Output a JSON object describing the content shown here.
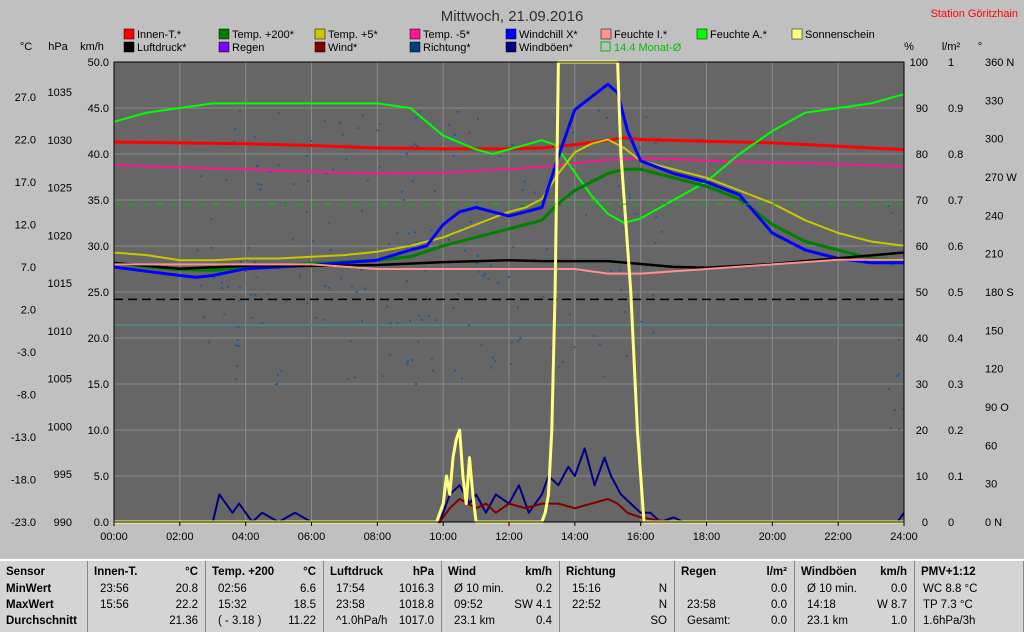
{
  "title": "Mittwoch, 21.09.2016",
  "station": "Station Göritzhain",
  "colors": {
    "bg": "#c0c0c0",
    "plot": "#666666"
  },
  "legend": [
    {
      "label": "Innen-T.*",
      "color": "#ff0000"
    },
    {
      "label": "Temp. +200*",
      "color": "#008000"
    },
    {
      "label": "Temp. +5*",
      "color": "#c8c800"
    },
    {
      "label": "Temp. -5*",
      "color": "#ff1493"
    },
    {
      "label": "Windchill X*",
      "color": "#0000ff"
    },
    {
      "label": "Feuchte I.*",
      "color": "#ff9090"
    },
    {
      "label": "Feuchte A.*",
      "color": "#00ff00"
    },
    {
      "label": "Sonnenschein",
      "color": "#ffff80"
    },
    {
      "label": "Luftdruck*",
      "color": "#000000"
    },
    {
      "label": "Regen",
      "color": "#8000ff"
    },
    {
      "label": "Wind*",
      "color": "#800000"
    },
    {
      "label": "Richtung*",
      "color": "#004080"
    },
    {
      "label": "Windböen*",
      "color": "#000080"
    },
    {
      "label": "14.4 Monat-Ø",
      "color": "#00c000",
      "box": true
    }
  ],
  "chart_data": {
    "type": "line",
    "title": "Mittwoch, 21.09.2016",
    "x_ticks": [
      "00:00",
      "02:00",
      "04:00",
      "06:00",
      "08:00",
      "10:00",
      "12:00",
      "14:00",
      "16:00",
      "18:00",
      "20:00",
      "22:00",
      "24:00"
    ],
    "xlim": [
      0,
      24
    ],
    "axes": {
      "celsius": {
        "label": "°C",
        "ticks": [
          "27.0",
          "22.0",
          "17.0",
          "12.0",
          "7.0",
          "2.0",
          "-3.0",
          "-8.0",
          "-13.0",
          "-18.0",
          "-23.0"
        ]
      },
      "hpa": {
        "label": "hPa",
        "ticks": [
          "1035",
          "1030",
          "1025",
          "1020",
          "1015",
          "1010",
          "1005",
          "1000",
          "995",
          "990"
        ]
      },
      "kmh": {
        "label": "km/h",
        "ticks": [
          "50.0",
          "45.0",
          "40.0",
          "35.0",
          "30.0",
          "25.0",
          "20.0",
          "15.0",
          "10.0",
          "5.0",
          "0.0"
        ]
      },
      "percent": {
        "label": "%",
        "ticks": [
          "100",
          "90",
          "80",
          "70",
          "60",
          "50",
          "40",
          "30",
          "20",
          "10",
          "0"
        ]
      },
      "lm2": {
        "label": "l/m²",
        "ticks": [
          "1",
          "0.9",
          "0.8",
          "0.7",
          "0.6",
          "0.5",
          "0.4",
          "0.3",
          "0.2",
          "0.1",
          "0"
        ]
      },
      "degree": {
        "label": "°",
        "ticks": [
          "360 N",
          "330",
          "300",
          "270 W",
          "240",
          "210",
          "180 S",
          "150",
          "120",
          "90 O",
          "60",
          "30",
          "0 N"
        ]
      }
    },
    "series": [
      {
        "name": "Innen-T.*",
        "axis": "celsius",
        "x": [
          0,
          2,
          4,
          6,
          8,
          10,
          12,
          13,
          14,
          15,
          15.5,
          16,
          18,
          20,
          22,
          24
        ],
        "y": [
          21.7,
          21.6,
          21.5,
          21.3,
          21.0,
          20.9,
          20.9,
          21.0,
          21.4,
          21.9,
          22.2,
          22.0,
          21.8,
          21.6,
          21.2,
          20.8
        ]
      },
      {
        "name": "Temp. -5*",
        "axis": "celsius",
        "x": [
          0,
          2,
          4,
          6,
          8,
          10,
          12,
          13,
          14,
          15,
          16,
          17,
          18,
          20,
          22,
          24
        ],
        "y": [
          19.0,
          18.7,
          18.5,
          18.2,
          18.0,
          18.1,
          18.5,
          18.8,
          19.2,
          19.6,
          19.8,
          19.7,
          19.5,
          19.3,
          19.1,
          18.8
        ]
      },
      {
        "name": "Feuchte A.*",
        "axis": "percent",
        "x": [
          0,
          0.5,
          1,
          2,
          3,
          4,
          6,
          8,
          9,
          9.5,
          10,
          11,
          11.5,
          12,
          12.5,
          13,
          13.4,
          14,
          14.5,
          15,
          15.5,
          16,
          17,
          18,
          19,
          20,
          21,
          22,
          23,
          24
        ],
        "y": [
          87,
          88,
          89,
          90,
          91,
          91,
          91,
          91,
          90,
          87,
          84,
          81,
          80,
          81,
          82,
          83,
          82,
          76,
          71,
          67,
          65,
          66,
          70,
          74,
          80,
          85,
          89,
          90,
          91,
          93
        ]
      },
      {
        "name": "Temp. +5*",
        "axis": "celsius",
        "x": [
          0,
          1,
          2,
          3,
          4,
          5,
          6,
          7,
          8,
          9,
          10,
          11,
          12,
          12.5,
          13,
          13.5,
          14,
          14.5,
          15,
          15.5,
          16,
          17,
          18,
          19,
          20,
          21,
          22,
          23,
          24
        ],
        "y": [
          8.7,
          8.4,
          7.8,
          7.8,
          8.0,
          8.0,
          8.2,
          8.4,
          8.8,
          9.5,
          10.5,
          12.0,
          13.5,
          14.0,
          15.0,
          18.0,
          20.5,
          21.5,
          22.0,
          21.0,
          19.5,
          18.5,
          17.5,
          16.0,
          14.5,
          12.5,
          11.0,
          10.0,
          9.5
        ]
      },
      {
        "name": "Temp. +200*",
        "axis": "celsius",
        "x": [
          0,
          1,
          2,
          3,
          4,
          5,
          6,
          7,
          8,
          9,
          10,
          11,
          12,
          12.5,
          13,
          13.5,
          14,
          14.5,
          15,
          15.5,
          16,
          17,
          18,
          19,
          20,
          21,
          22,
          23,
          24
        ],
        "y": [
          7.5,
          7.0,
          6.7,
          6.6,
          7.0,
          7.2,
          7.4,
          7.6,
          7.8,
          8.2,
          9.5,
          10.5,
          11.5,
          12.0,
          12.5,
          14.5,
          16.0,
          17.0,
          18.0,
          18.5,
          18.5,
          17.5,
          16.5,
          15.0,
          12.0,
          10.0,
          9.0,
          8.0,
          7.8
        ]
      },
      {
        "name": "Windchill X*",
        "axis": "celsius",
        "x": [
          0,
          1,
          2,
          2.5,
          3,
          4,
          5,
          6,
          7,
          8,
          9,
          9.5,
          10,
          10.5,
          11,
          11.5,
          12,
          12.5,
          13,
          13.5,
          14,
          14.5,
          15,
          15.3,
          15.6,
          16,
          17,
          18,
          19,
          20,
          21,
          22,
          23,
          24
        ],
        "y": [
          7.0,
          6.5,
          6.0,
          5.8,
          6.0,
          6.8,
          7.0,
          7.2,
          7.5,
          7.8,
          9.0,
          9.5,
          12.0,
          13.5,
          14.0,
          13.5,
          13.0,
          13.5,
          14.0,
          20.0,
          25.5,
          27.0,
          28.5,
          27.5,
          23.0,
          19.5,
          18.0,
          17.0,
          15.5,
          11.0,
          9.0,
          8.0,
          7.5,
          7.5
        ]
      },
      {
        "name": "Luftdruck*",
        "axis": "hpa",
        "x": [
          0,
          2,
          4,
          6,
          8,
          10,
          12,
          13,
          14,
          15,
          16,
          17,
          18,
          20,
          22,
          24
        ],
        "y": [
          1017.1,
          1016.5,
          1016.8,
          1016.8,
          1016.9,
          1017.2,
          1017.4,
          1017.3,
          1017.3,
          1017.3,
          1017.0,
          1016.7,
          1016.6,
          1017.0,
          1017.6,
          1018.2
        ]
      },
      {
        "name": "Feuchte I.*",
        "axis": "percent",
        "x": [
          0,
          2,
          4,
          6,
          8,
          10,
          12,
          14,
          15,
          16,
          18,
          20,
          22,
          24
        ],
        "y": [
          56,
          56,
          56,
          56,
          55,
          55,
          55,
          55,
          54,
          54,
          55,
          56,
          57,
          57
        ]
      },
      {
        "name": "Windböen*",
        "axis": "kmh",
        "x": [
          0,
          3,
          3.2,
          3.4,
          3.6,
          3.8,
          4,
          4.2,
          4.5,
          5,
          5.5,
          6,
          9.9,
          10.2,
          10.5,
          10.8,
          11,
          11.3,
          11.6,
          12,
          12.3,
          12.6,
          13,
          13.2,
          13.5,
          13.8,
          14,
          14.3,
          14.6,
          14.9,
          15.1,
          15.4,
          15.7,
          16,
          16.3,
          16.6,
          17,
          17.3,
          23.8,
          24
        ],
        "y": [
          0,
          0,
          3,
          2,
          1,
          2,
          1,
          0,
          1,
          0,
          1,
          0,
          0,
          3,
          4,
          2,
          3,
          1,
          3,
          2,
          4,
          1,
          3,
          5,
          4,
          6,
          5,
          8,
          4,
          7,
          5,
          3,
          2,
          1,
          1,
          0,
          0.5,
          0,
          0,
          1
        ]
      },
      {
        "name": "Wind*",
        "axis": "kmh",
        "x": [
          0,
          9.9,
          10.2,
          10.5,
          11,
          11.3,
          11.6,
          12,
          12.5,
          13,
          13.5,
          14,
          14.5,
          15,
          15.3,
          15.6,
          16,
          16.5,
          17,
          24
        ],
        "y": [
          0,
          0,
          1.5,
          2.5,
          1.5,
          2.0,
          1.0,
          2.0,
          1.5,
          2.0,
          2.0,
          1.5,
          2.0,
          2.5,
          2.0,
          1.0,
          0.5,
          0.2,
          0,
          0
        ]
      },
      {
        "name": "Sonnenschein",
        "axis": "kmh",
        "x": [
          0,
          9.8,
          10,
          10.1,
          10.2,
          10.3,
          10.4,
          10.5,
          10.6,
          10.7,
          10.8,
          10.9,
          11.0,
          11.1,
          13.0,
          13.1,
          13.2,
          13.3,
          13.4,
          13.5,
          15.3,
          15.4,
          15.5,
          15.7,
          15.9,
          16.1,
          24
        ],
        "y": [
          0,
          0,
          2,
          5,
          3,
          7,
          9,
          10,
          5,
          2,
          7,
          3,
          0,
          0,
          0,
          1,
          3,
          10,
          25,
          50,
          50,
          40,
          35,
          25,
          10,
          0,
          0
        ]
      },
      {
        "name": "14.4 Monat-Ø",
        "axis": "celsius",
        "x": [
          0,
          24
        ],
        "y": [
          14.4,
          14.4
        ]
      }
    ],
    "ref_lines": [
      {
        "axis": "kmh",
        "value": 24.2,
        "style": "dashed",
        "color": "#000000"
      },
      {
        "axis": "kmh",
        "value": 21.4,
        "style": "solid",
        "color": "#4a9090"
      }
    ]
  },
  "stats": {
    "sensor": {
      "title": "Sensor",
      "rows": [
        "MinWert",
        "MaxWert",
        "Durchschnitt"
      ]
    },
    "innen": {
      "title": "Innen-T.",
      "unit": "°C",
      "r1": [
        "23:56",
        "20.8"
      ],
      "r2": [
        "15:56",
        "22.2"
      ],
      "r3": [
        "",
        "21.36"
      ]
    },
    "temp200": {
      "title": "Temp. +200",
      "unit": "°C",
      "r1": [
        "02:56",
        "6.6"
      ],
      "r2": [
        "15:32",
        "18.5"
      ],
      "r3": [
        "( - 3.18 )",
        "11.22"
      ]
    },
    "luft": {
      "title": "Luftdruck",
      "unit": "hPa",
      "r1": [
        "17:54",
        "1016.3"
      ],
      "r2": [
        "23:58",
        "1018.8"
      ],
      "r3": [
        "^1.0hPa/h",
        "1017.0"
      ]
    },
    "wind": {
      "title": "Wind",
      "unit": "km/h",
      "r1": [
        "Ø 10 min.",
        "0.2"
      ],
      "r2": [
        "09:52",
        "SW 4.1"
      ],
      "r3": [
        "23.1 km",
        "0.4"
      ]
    },
    "richtung": {
      "title": "Richtung",
      "unit": "",
      "r1": [
        "15:16",
        "N"
      ],
      "r2": [
        "22:52",
        "N"
      ],
      "r3": [
        "",
        "SO"
      ]
    },
    "regen": {
      "title": "Regen",
      "unit": "l/m²",
      "r1": [
        "",
        "0.0"
      ],
      "r2": [
        "23:58",
        "0.0"
      ],
      "r3": [
        "Gesamt:",
        "0.0"
      ]
    },
    "boeen": {
      "title": "Windböen",
      "unit": "km/h",
      "r1": [
        "Ø 10 min.",
        "0.0"
      ],
      "r2": [
        "14:18",
        "W 8.7"
      ],
      "r3": [
        "23.1 km",
        "1.0"
      ]
    },
    "pmv": {
      "title": "PMV+1:12",
      "r1": "WC 8.8 °C",
      "r2": "TP 7.3 °C",
      "r3": "1.6hPa/3h"
    }
  }
}
